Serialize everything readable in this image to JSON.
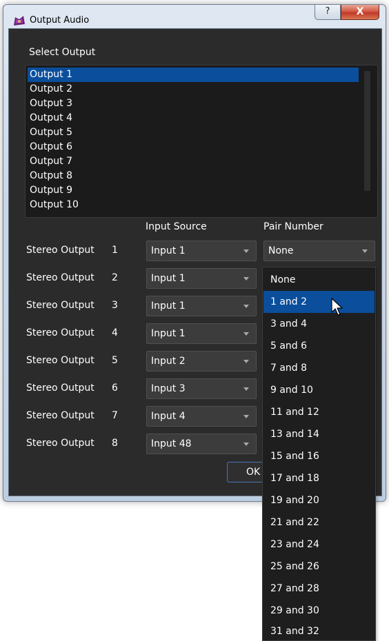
{
  "window": {
    "title": "Output Audio",
    "help_label": "?",
    "close_label": "X"
  },
  "select_output": {
    "label": "Select Output",
    "items": [
      "Output 1",
      "Output 2",
      "Output 3",
      "Output 4",
      "Output 5",
      "Output 6",
      "Output 7",
      "Output 8",
      "Output 9",
      "Output 10"
    ],
    "selected": "Output 1"
  },
  "columns": {
    "input_source": "Input Source",
    "pair_number": "Pair Number"
  },
  "stereo_rows": [
    {
      "label": "Stereo Output",
      "number": "1",
      "input": "Input 1"
    },
    {
      "label": "Stereo Output",
      "number": "2",
      "input": "Input 1"
    },
    {
      "label": "Stereo Output",
      "number": "3",
      "input": "Input 1"
    },
    {
      "label": "Stereo Output",
      "number": "4",
      "input": "Input 1"
    },
    {
      "label": "Stereo Output",
      "number": "5",
      "input": "Input 2"
    },
    {
      "label": "Stereo Output",
      "number": "6",
      "input": "Input 3"
    },
    {
      "label": "Stereo Output",
      "number": "7",
      "input": "Input 4"
    },
    {
      "label": "Stereo Output",
      "number": "8",
      "input": "Input 48"
    }
  ],
  "pair_combo": {
    "value": "None"
  },
  "ok_button": {
    "label": "OK"
  },
  "pair_dropdown": {
    "options": [
      "None",
      "1 and 2",
      "3 and 4",
      "5 and 6",
      "7 and 8",
      "9 and 10",
      "11 and 12",
      "13 and 14",
      "15 and 16",
      "17 and 18",
      "19 and 20",
      "21 and 22",
      "23 and 24",
      "25 and 26",
      "27 and 28",
      "29 and 30",
      "31 and 32"
    ],
    "highlighted": "1 and 2"
  },
  "colors": {
    "selection": "#0a4e9c",
    "panel_bg": "#2b2b2b",
    "list_bg": "#1b1b1b"
  },
  "icons": {
    "app": "app-icon",
    "help": "help-icon",
    "close": "close-icon",
    "dropdown_arrow": "chevron-down-icon",
    "cursor": "mouse-cursor-icon"
  }
}
